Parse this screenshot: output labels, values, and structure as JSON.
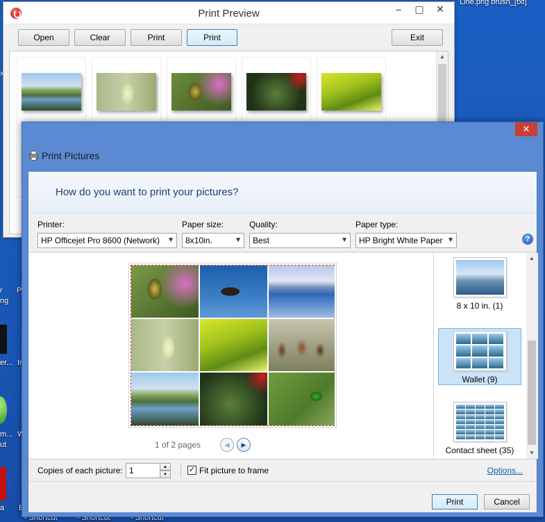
{
  "desktop": {
    "top_text": "Line.png     brush_[txt]",
    "left_labels": [
      "x",
      "r",
      "ng",
      "P",
      "er...",
      "In",
      "m...",
      "ut",
      "W",
      "a",
      "E"
    ],
    "bottom_shortcuts": [
      "- Shortcut",
      "- Shortcut",
      "- Shortcut"
    ]
  },
  "print_preview": {
    "title": "Print Preview",
    "buttons": {
      "open": "Open",
      "clear": "Clear",
      "print1": "Print",
      "print2": "Print",
      "exit": "Exit"
    },
    "window_controls": {
      "minimize": "–",
      "maximize": "▢",
      "close": "✕"
    }
  },
  "print_pictures": {
    "title": "Print Pictures",
    "close": "✕",
    "question": "How do you want to print your pictures?",
    "printer": {
      "label": "Printer:",
      "value": "HP Officejet Pro 8600 (Network)"
    },
    "paper_size": {
      "label": "Paper size:",
      "value": "8x10in."
    },
    "quality": {
      "label": "Quality:",
      "value": "Best"
    },
    "paper_type": {
      "label": "Paper type:",
      "value": "HP Bright White Paper"
    },
    "help": "?",
    "page_info": "1 of 2 pages",
    "layouts": [
      {
        "label": "8 x 10 in. (1)",
        "selected": false
      },
      {
        "label": "Wallet (9)",
        "selected": true
      },
      {
        "label": "Contact sheet (35)",
        "selected": false
      }
    ],
    "copies": {
      "label": "Copies of each picture:",
      "value": "1"
    },
    "fit": {
      "label": "Fit picture to frame",
      "checked": true,
      "check_glyph": "✓"
    },
    "options_link": "Options...",
    "print_button": "Print",
    "cancel_button": "Cancel"
  }
}
